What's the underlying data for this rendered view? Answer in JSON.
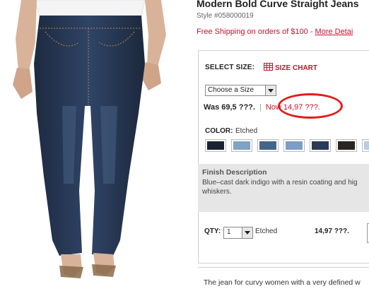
{
  "product": {
    "title": "Modern Bold Curve Straight Jeans",
    "style_number": "Style #058000019",
    "shipping_text": "Free Shipping on orders of $100 - ",
    "shipping_link": "More Detai",
    "image": "model-wearing-dark-indigo-straight-jeans"
  },
  "size": {
    "label": "SELECT SIZE:",
    "chart_label": "SIZE CHART",
    "select_value": "Choose a Size"
  },
  "price": {
    "was": "Was 69,5 ???.",
    "separator": "|",
    "now": "Now 14,97 ???.",
    "highlight_color": "#e21c1c"
  },
  "color": {
    "label": "COLOR:",
    "selected": "Etched",
    "swatches": [
      "#1a2333",
      "#7fa3c4",
      "#44658c",
      "#7c9ec5",
      "#2b3a57",
      "#2a2420",
      "#b9cde0"
    ]
  },
  "finish": {
    "title": "Finish Description",
    "text": "Blue–cast dark indigo with a resin coating and hig whiskers."
  },
  "quantity": {
    "label": "QTY:",
    "value": "1",
    "finish": "Etched",
    "price": "14,97 ???."
  },
  "description": "The jean for curvy women with a very defined w",
  "colors": {
    "accent_red": "#c41230",
    "panel_gray": "#e6e6e6"
  }
}
